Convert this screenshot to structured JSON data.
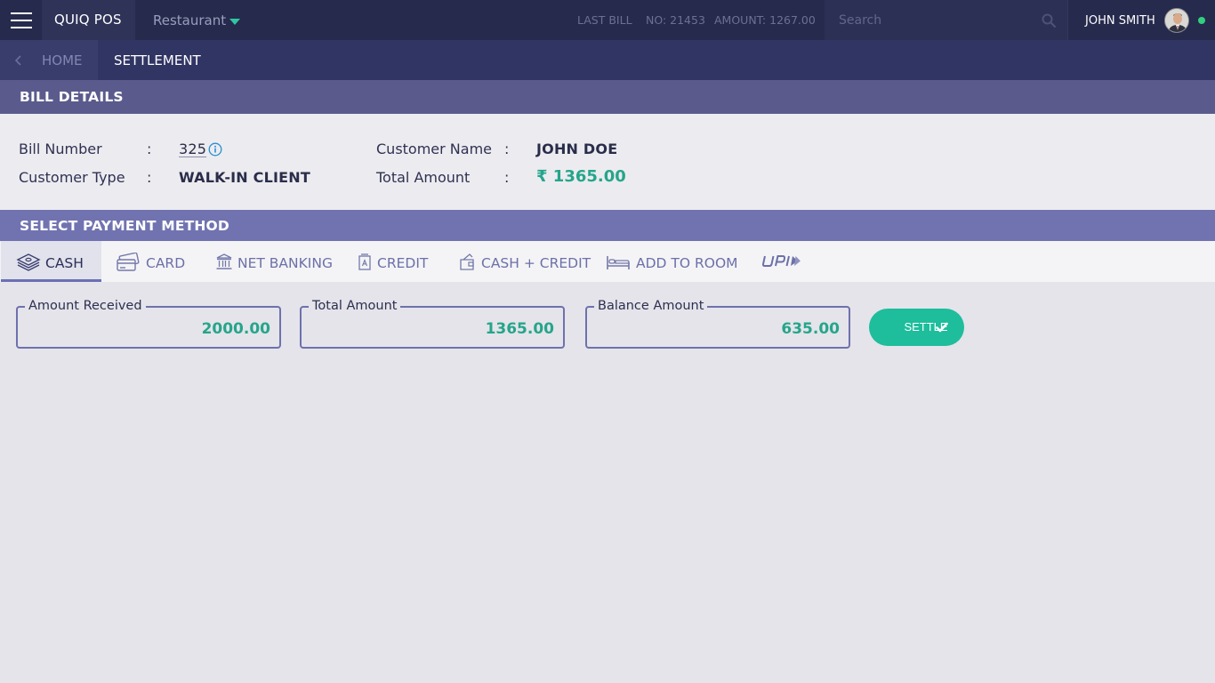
{
  "app": {
    "name": "QUIQ POS",
    "outlet": "Restaurant"
  },
  "last_bill": {
    "label": "LAST BILL",
    "no": "NO: 21453",
    "amount": "AMOUNT: 1267.00"
  },
  "search": {
    "placeholder": "Search",
    "value": ""
  },
  "user": {
    "name": "JOHN SMITH",
    "status": "online"
  },
  "breadcrumb": {
    "home": "HOME",
    "current": "SETTLEMENT"
  },
  "bill_details": {
    "title": "BILL DETAILS",
    "bill_number_label": "Bill Number",
    "bill_number": "325",
    "customer_type_label": "Customer Type",
    "customer_type": "WALK-IN CLIENT",
    "customer_name_label": "Customer Name",
    "customer_name": "JOHN DOE",
    "total_amount_label": "Total Amount",
    "total_amount": "₹ 1365.00",
    "separator": ":"
  },
  "payment": {
    "title": "SELECT PAYMENT METHOD",
    "tabs": [
      {
        "label": "CASH",
        "icon": "cash-icon",
        "active": true
      },
      {
        "label": "CARD",
        "icon": "card-icon",
        "active": false
      },
      {
        "label": "NET BANKING",
        "icon": "bank-icon",
        "active": false
      },
      {
        "label": "CREDIT",
        "icon": "credit-icon",
        "active": false
      },
      {
        "label": "CASH + CREDIT",
        "icon": "cash-credit-icon",
        "active": false
      },
      {
        "label": "ADD TO ROOM",
        "icon": "bed-icon",
        "active": false
      },
      {
        "label": "UPI",
        "icon": "upi-logo",
        "active": false
      }
    ],
    "amount_received_label": "Amount Received",
    "amount_received": "2000.00",
    "total_amount_label": "Total Amount",
    "total_amount": "1365.00",
    "balance_amount_label": "Balance Amount",
    "balance_amount": "635.00",
    "settle_label": "SETTLE"
  },
  "colors": {
    "accent": "#1ebd9c",
    "topbar": "#262a4d",
    "amount_green": "#26a58b"
  }
}
